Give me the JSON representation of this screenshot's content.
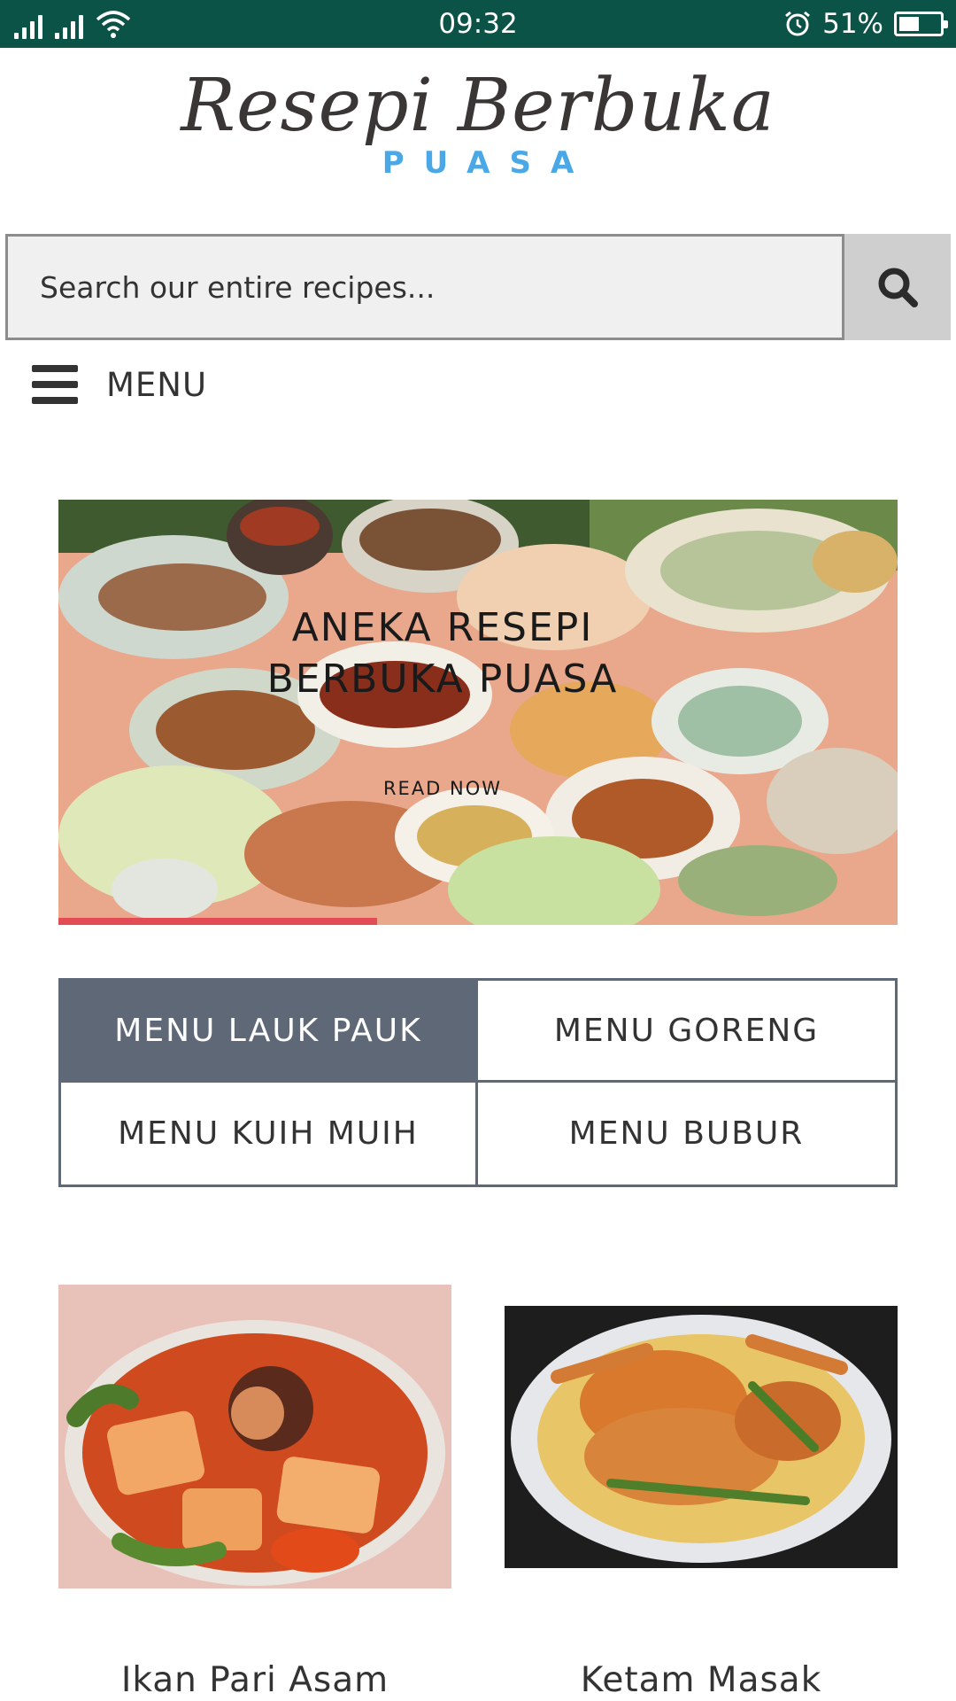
{
  "status_bar": {
    "time": "09:32",
    "battery_text": "51%",
    "battery_level": 0.51,
    "icons": [
      "signal-icon",
      "signal-icon",
      "wifi-icon",
      "alarm-icon",
      "battery-icon"
    ]
  },
  "header": {
    "logo_script": "Resepi Berbuka",
    "logo_sub": "PUASA"
  },
  "search": {
    "placeholder": "Search our entire recipes...",
    "button_icon": "search-icon"
  },
  "menu_toggle": {
    "label": "MENU",
    "icon": "hamburger-icon"
  },
  "hero": {
    "title_line1": "ANEKA RESEPI",
    "title_line2": "BERBUKA PUASA",
    "cta": "READ NOW",
    "progress": 0.38
  },
  "categories": [
    {
      "label": "MENU LAUK PAUK",
      "active": true
    },
    {
      "label": "MENU GORENG",
      "active": false
    },
    {
      "label": "MENU KUIH MUIH",
      "active": false
    },
    {
      "label": "MENU BUBUR",
      "active": false
    }
  ],
  "recipes": [
    {
      "title": "Ikan Pari Asam"
    },
    {
      "title": "Ketam Masak"
    }
  ],
  "colors": {
    "status_bar": "#0b5247",
    "logo_sub": "#4aa8e6",
    "active_category": "#5f6877",
    "progress": "#e44c55"
  }
}
